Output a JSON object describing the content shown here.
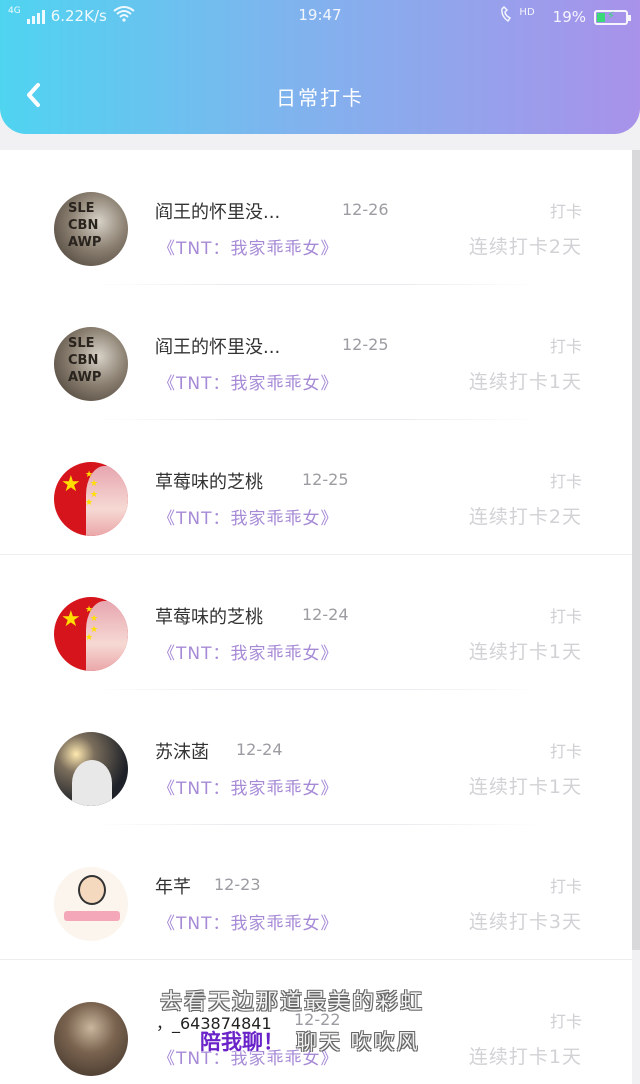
{
  "status_bar": {
    "network": "4G",
    "speed": "6.22K/s",
    "time": "19:47",
    "hd": "HD",
    "battery": "19%",
    "battery_color": "#2fe06b"
  },
  "header": {
    "title": "日常打卡",
    "back_icon": "chevron-left-icon",
    "gradient": [
      "#4fd4f0",
      "#a892ea"
    ]
  },
  "colors": {
    "group_text": "#a68ad6",
    "streak_text": "#d2d2d6"
  },
  "rows": [
    {
      "name": "阎王的怀里没...",
      "date": "12-26",
      "status": "打卡",
      "group": "《TNT：我家乖乖女》",
      "streak": "连续打卡2天",
      "avatar": "sweater-avatar"
    },
    {
      "name": "阎王的怀里没...",
      "date": "12-25",
      "status": "打卡",
      "group": "《TNT：我家乖乖女》",
      "streak": "连续打卡1天",
      "avatar": "sweater-avatar"
    },
    {
      "name": "草莓味的芝桃",
      "date": "12-25",
      "status": "打卡",
      "group": "《TNT：我家乖乖女》",
      "streak": "连续打卡2天",
      "avatar": "flag-avatar"
    },
    {
      "name": "草莓味的芝桃",
      "date": "12-24",
      "status": "打卡",
      "group": "《TNT：我家乖乖女》",
      "streak": "连续打卡1天",
      "avatar": "flag-avatar"
    },
    {
      "name": "苏沫菡",
      "date": "12-24",
      "status": "打卡",
      "group": "《TNT：我家乖乖女》",
      "streak": "连续打卡1天",
      "avatar": "night-avatar"
    },
    {
      "name": "年芊",
      "date": "12-23",
      "status": "打卡",
      "group": "《TNT：我家乖乖女》",
      "streak": "连续打卡3天",
      "avatar": "cartoon-avatar"
    },
    {
      "name": "",
      "date": "12-22",
      "status": "打卡",
      "group": "《TNT：我家乖乖女》",
      "streak": "连续打卡1天",
      "avatar": "boy-avatar"
    }
  ],
  "overlay": {
    "line1": "去看天边那道最美的彩虹",
    "line2": "，_643874841",
    "line3": "陪我聊！",
    "line4": "聊天 吹吹风"
  }
}
